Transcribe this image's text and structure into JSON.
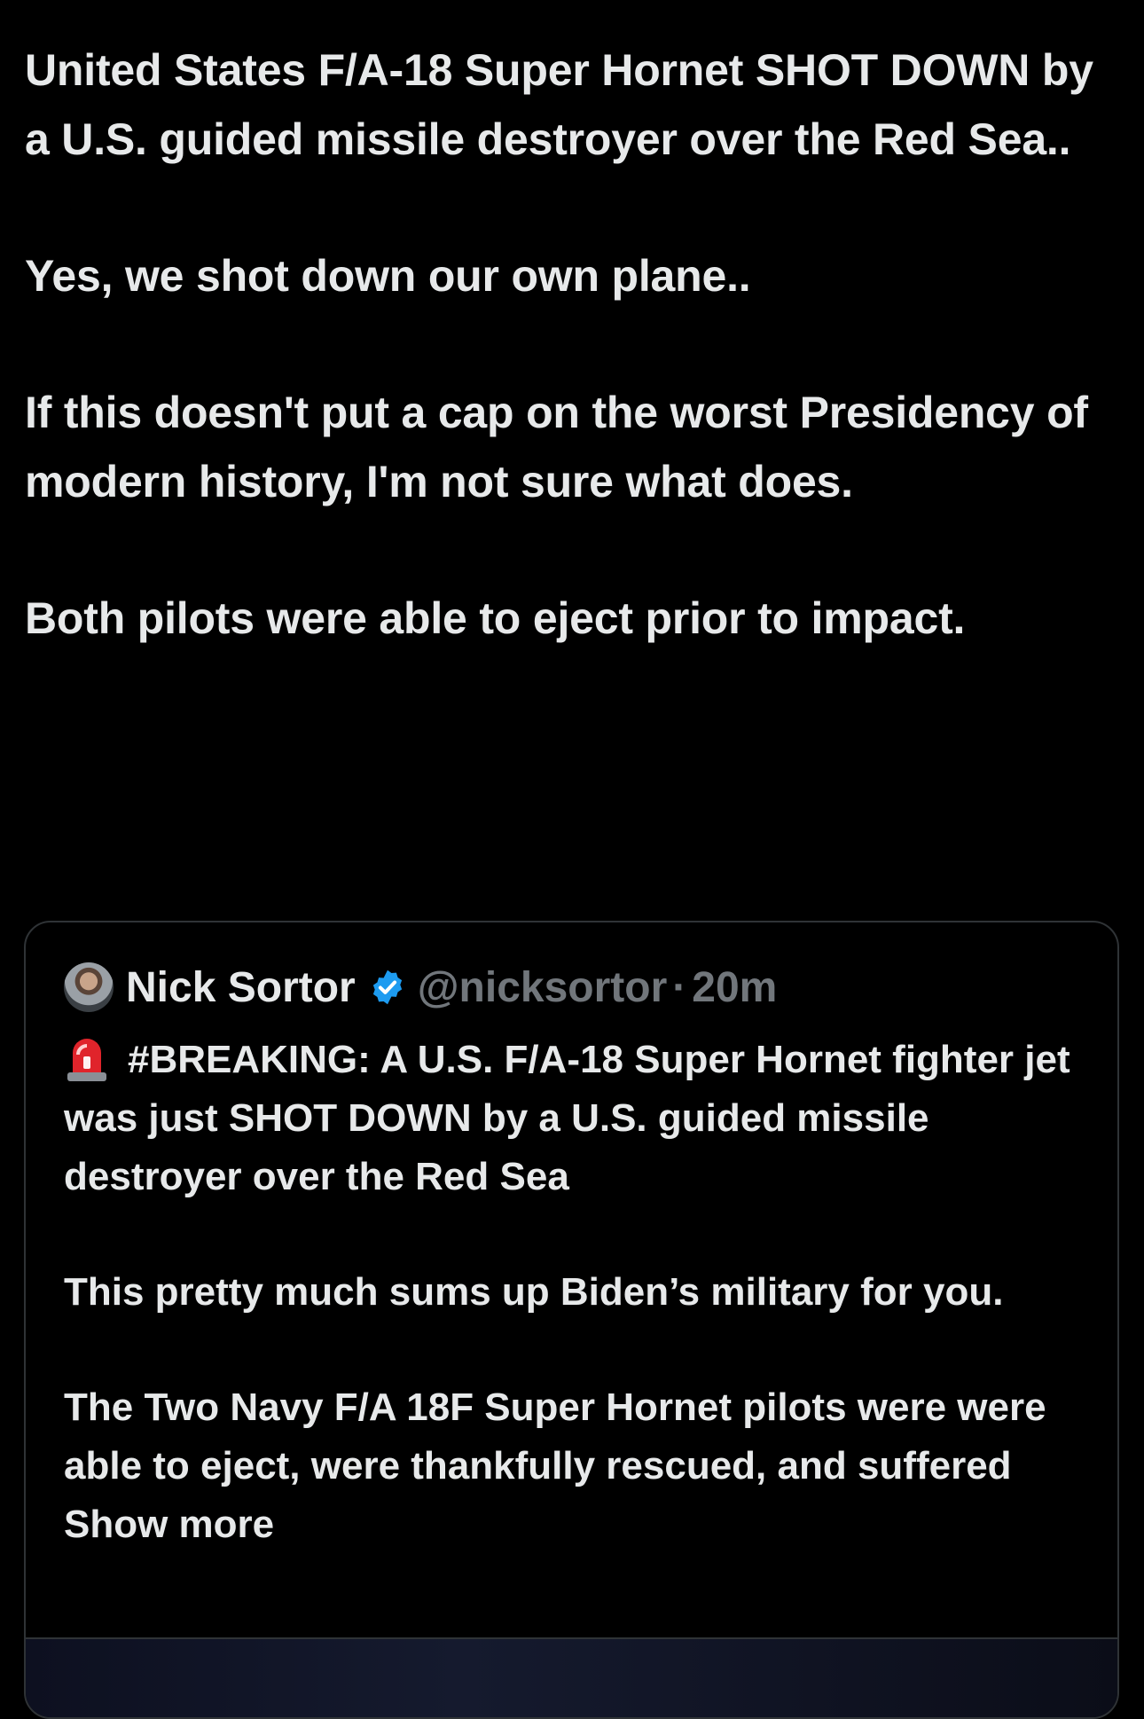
{
  "post": {
    "paragraphs": [
      "United States F/A-18 Super Hornet SHOT DOWN by a U.S. guided missile destroyer over the Red Sea..",
      "Yes, we shot down our own plane..",
      "If this doesn't put a cap on the worst Presidency of modern history, I'm not sure what does.",
      "Both pilots were able to eject prior to impact."
    ]
  },
  "quote": {
    "author_name": "Nick Sortor",
    "handle": "@nicksortor",
    "separator": "·",
    "time": "20m",
    "verified_icon": "verified-badge-icon",
    "siren_icon": "police-siren-icon",
    "paragraph_1": "#BREAKING: A U.S. F/A-18 Super Hornet fighter jet was just SHOT DOWN by a U.S. guided missile destroyer over the Red Sea",
    "paragraph_2": "This pretty much sums up Biden’s military for you.",
    "paragraph_3": "The Two Navy F/A 18F Super Hornet pilots were were able to eject, were thankfully rescued, and suffered",
    "show_more": "Show more"
  },
  "colors": {
    "background": "#000000",
    "text": "#e7e9ea",
    "muted": "#71767b",
    "border": "#2f3336",
    "verified": "#1d9bf0"
  }
}
